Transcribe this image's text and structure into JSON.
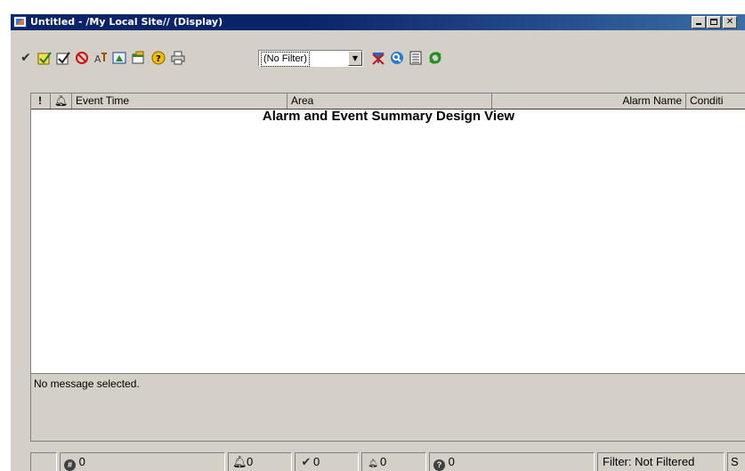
{
  "window": {
    "title": "Untitled - /My Local Site// (Display)"
  },
  "toolbar": {
    "filter_value": "(No Filter)",
    "icons": [
      "acknowledge-icon",
      "acknowledge-page-icon",
      "acknowledge-selected-icon",
      "disable-icon",
      "suppress-icon",
      "shelve-icon",
      "properties-icon",
      "help-icon",
      "print-icon",
      "clear-filter-icon",
      "search-icon",
      "list-icon",
      "refresh-icon"
    ]
  },
  "grid": {
    "columns": [
      "!",
      "",
      "Event Time",
      "Area",
      "Alarm Name",
      "Conditi"
    ],
    "design_title": "Alarm and Event Summary Design View"
  },
  "details": {
    "message": "No message selected."
  },
  "status": {
    "total": "0",
    "alarms": "0",
    "acked": "0",
    "low": "0",
    "unknown": "0",
    "filter": "Filter: Not Filtered",
    "extra": "S"
  },
  "colors": {
    "titlebar": "#0a246a",
    "chrome": "#d4d0c8"
  }
}
